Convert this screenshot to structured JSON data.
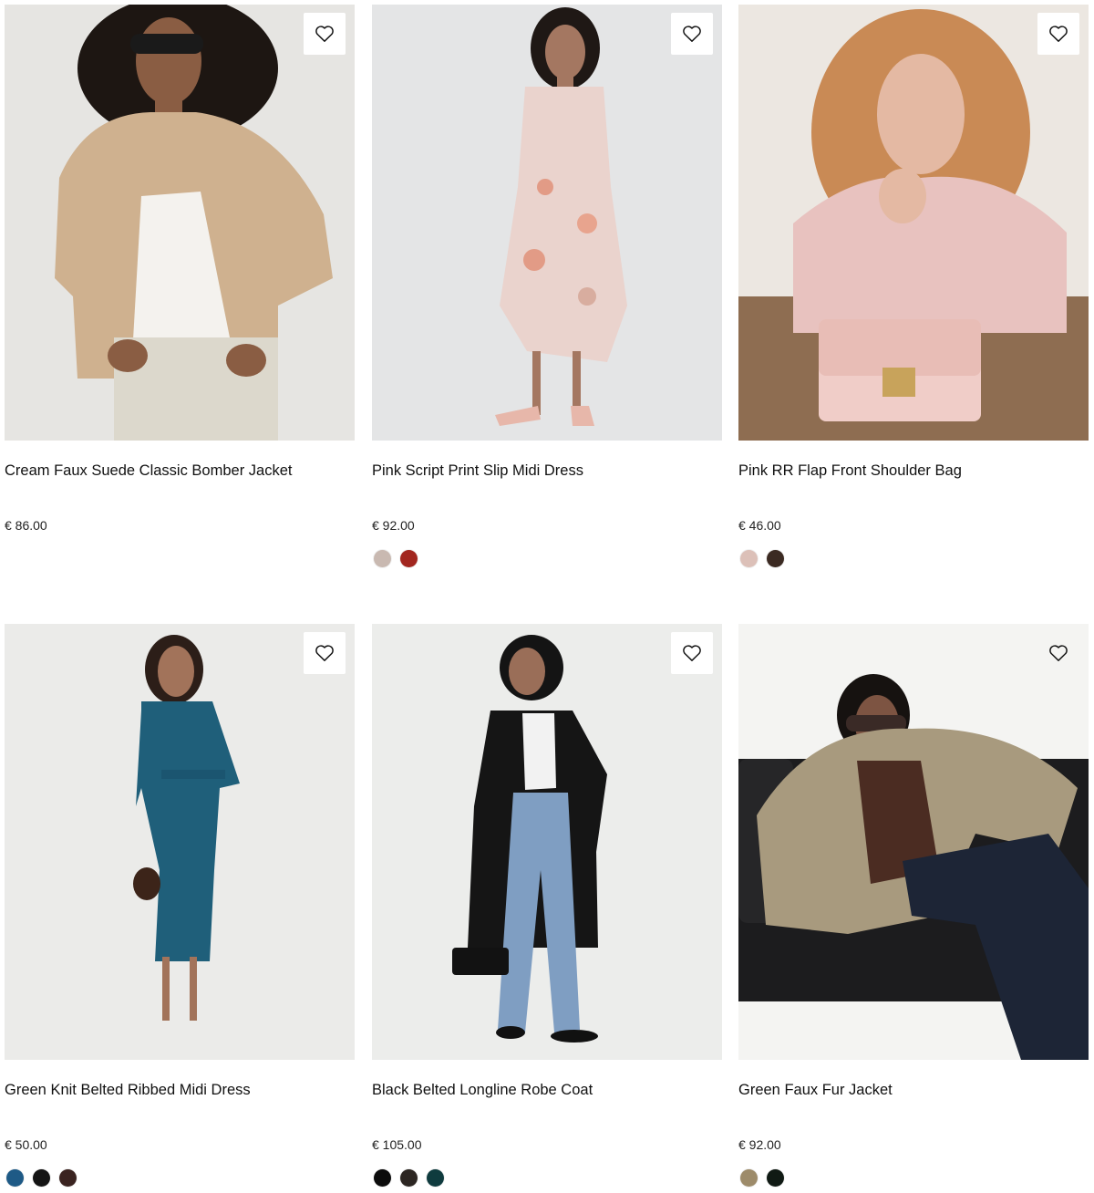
{
  "products": [
    {
      "title": "Cream Faux Suede Classic Bomber Jacket",
      "price": "€ 86.00",
      "colors": [],
      "wishlist_icon": "heart-outline-icon",
      "photo_tones": {
        "bg": "#e6e5e2",
        "garment": "#cfb18f",
        "inner": "#f4f2ee",
        "skin": "#8a5d43",
        "hair": "#1d1612",
        "bottom": "#dcd8cc"
      }
    },
    {
      "title": "Pink Script Print Slip Midi Dress",
      "price": "€ 92.00",
      "colors": [
        "#c9b9b1",
        "#a2261f"
      ],
      "wishlist_icon": "heart-outline-icon",
      "photo_tones": {
        "bg": "#e4e5e6",
        "garment": "#ead3cd",
        "inner": "#e9c4ba",
        "skin": "#a47761",
        "hair": "#1f1815",
        "bottom": "#e7b7aa"
      }
    },
    {
      "title": "Pink RR Flap Front Shoulder Bag",
      "price": "€ 46.00",
      "colors": [
        "#dcc0b8",
        "#3b2a22"
      ],
      "wishlist_icon": "heart-outline-icon",
      "photo_tones": {
        "bg": "#ece7e1",
        "garment": "#e8c2bf",
        "inner": "#f0cdc8",
        "skin": "#e4b9a3",
        "hair": "#c98a55",
        "bottom": "#8e6d51"
      }
    },
    {
      "title": "Green Knit Belted Ribbed Midi Dress",
      "price": "€ 50.00",
      "colors": [
        "#1e5a86",
        "#141414",
        "#3a2320"
      ],
      "wishlist_icon": "heart-outline-icon",
      "photo_tones": {
        "bg": "#ebebe9",
        "garment": "#1f5f7a",
        "inner": "#1b5570",
        "skin": "#a2735a",
        "hair": "#2c1e18",
        "bottom": "#1f5f7a"
      }
    },
    {
      "title": "Black Belted Longline Robe Coat",
      "price": "€ 105.00",
      "colors": [
        "#0c0c0c",
        "#2c2622",
        "#0f3b3e"
      ],
      "wishlist_icon": "heart-outline-icon",
      "photo_tones": {
        "bg": "#ecedeb",
        "garment": "#151515",
        "inner": "#f2f2f2",
        "skin": "#9a6e58",
        "hair": "#141414",
        "bottom": "#7f9ec2"
      }
    },
    {
      "title": "Green Faux Fur Jacket",
      "price": "€ 92.00",
      "colors": [
        "#9d8b6a",
        "#101a14"
      ],
      "wishlist_icon": "heart-outline-icon",
      "photo_tones": {
        "bg": "#f4f4f2",
        "garment": "#a89a7e",
        "inner": "#4b2c22",
        "skin": "#7d5442",
        "hair": "#161210",
        "bottom": "#1d2536"
      }
    }
  ]
}
